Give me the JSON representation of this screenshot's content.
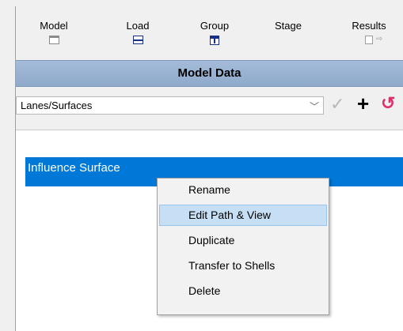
{
  "tabs": [
    {
      "label": "Model",
      "icon": "model-window-icon"
    },
    {
      "label": "Load",
      "icon": "load-window-icon"
    },
    {
      "label": "Group",
      "icon": "group-window-icon"
    },
    {
      "label": "Stage",
      "icon": "stage-window-icon"
    },
    {
      "label": "Results",
      "icon": "results-window-icon"
    }
  ],
  "section": {
    "title": "Model Data"
  },
  "dropdown": {
    "selected": "Lanes/Surfaces"
  },
  "toolbar": {
    "check_icon": "✓",
    "add_icon": "+",
    "undo_icon": "↺"
  },
  "list": {
    "items": [
      {
        "label": "Influence Surface",
        "selected": true
      }
    ]
  },
  "context_menu": {
    "items": [
      {
        "label": "Rename"
      },
      {
        "label": "Edit Path & View",
        "hovered": true
      },
      {
        "label": "Duplicate"
      },
      {
        "label": "Transfer to Shells"
      },
      {
        "label": "Delete"
      }
    ]
  },
  "colors": {
    "header_bg": "#9fb7d4",
    "selection_bg": "#0078d7",
    "menu_hover_bg": "#c7dff5",
    "undo_color": "#e0306a",
    "icon_blue": "#1a2f86"
  }
}
